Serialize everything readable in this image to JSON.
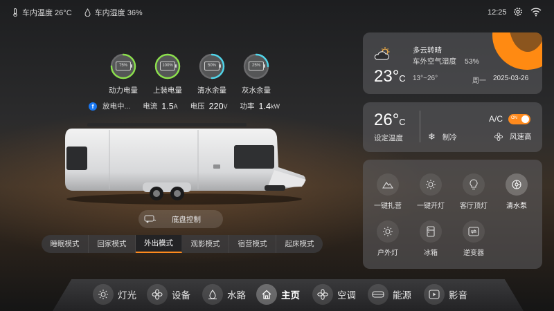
{
  "status": {
    "indoor_temp": "车内温度 26°C",
    "indoor_humidity": "车内湿度 36%",
    "time": "12:25"
  },
  "gauges": [
    {
      "pct": "75%",
      "label": "动力电量",
      "level": 0.75,
      "color": "#8be04b"
    },
    {
      "pct": "100%",
      "label": "上装电量",
      "level": 1.0,
      "color": "#8be04b"
    },
    {
      "pct": "50%",
      "label": "清水余量",
      "level": 0.5,
      "color": "#4fd5ea"
    },
    {
      "pct": "25%",
      "label": "灰水余量",
      "level": 0.25,
      "color": "#4fd5ea"
    }
  ],
  "power": {
    "state": "放电中...",
    "current_label": "电流",
    "current_value": "1.5",
    "current_unit": "A",
    "voltage_label": "电压",
    "voltage_value": "220",
    "voltage_unit": "V",
    "power_label": "功率",
    "power_value": "1.4",
    "power_unit": "kW"
  },
  "chassis_label": "底盘控制",
  "modes": [
    {
      "label": "睡眠模式",
      "active": false
    },
    {
      "label": "回家模式",
      "active": false
    },
    {
      "label": "外出模式",
      "active": true
    },
    {
      "label": "观影模式",
      "active": false
    },
    {
      "label": "宿营模式",
      "active": false
    },
    {
      "label": "起床模式",
      "active": false
    }
  ],
  "weather": {
    "temp": "23°",
    "temp_unit": "C",
    "condition": "多云转晴",
    "humidity_label": "车外空气湿度",
    "humidity_value": "53%",
    "range": "13°~26°",
    "weekday": "周一",
    "date": "2025-03-26"
  },
  "ac": {
    "temp": "26°",
    "temp_unit": "C",
    "set_label": "设定温度",
    "label": "A/C",
    "toggle_text": "ON",
    "mode": "制冷",
    "fan": "风速高"
  },
  "devices": [
    {
      "label": "一键扎营",
      "icon": "mountain-icon",
      "on": false
    },
    {
      "label": "一键开灯",
      "icon": "sun-icon",
      "on": false
    },
    {
      "label": "客厅顶灯",
      "icon": "bulb-icon",
      "on": false
    },
    {
      "label": "清水泵",
      "icon": "pump-icon",
      "on": true
    },
    {
      "label": "户外灯",
      "icon": "sun-icon",
      "on": false
    },
    {
      "label": "冰箱",
      "icon": "fridge-icon",
      "on": false
    },
    {
      "label": "逆变器",
      "icon": "inverter-icon",
      "on": false
    }
  ],
  "nav": [
    {
      "label": "灯光",
      "icon": "light-icon",
      "active": false
    },
    {
      "label": "设备",
      "icon": "devices-icon",
      "active": false
    },
    {
      "label": "水路",
      "icon": "water-icon",
      "active": false
    },
    {
      "label": "主页",
      "icon": "home-icon",
      "active": true
    },
    {
      "label": "空调",
      "icon": "fan-icon",
      "active": false
    },
    {
      "label": "能源",
      "icon": "energy-icon",
      "active": false
    },
    {
      "label": "影音",
      "icon": "media-icon",
      "active": false
    }
  ],
  "colors": {
    "accent": "#ff8a1d",
    "green": "#8be04b",
    "cyan": "#4fd5ea"
  }
}
